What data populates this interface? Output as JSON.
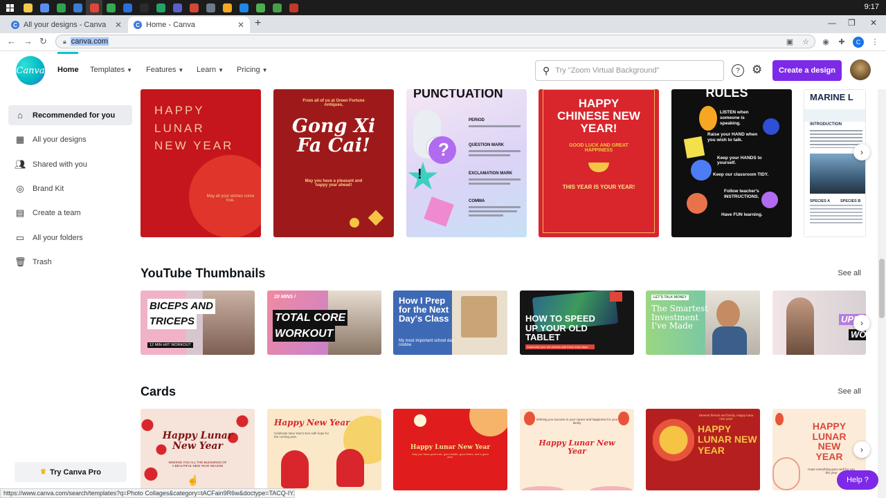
{
  "taskbar": {
    "clock": "9:17",
    "apps": [
      "#f2c94c",
      "#5b8def",
      "#2ea44f",
      "#3a7bd5",
      "#e0453a",
      "#34a853",
      "#2a6fdb",
      "#2b2b2b",
      "#21a366",
      "#5b5fc7",
      "#d14836",
      "#6b7b8c",
      "#f5a623",
      "#1e88e5",
      "#4caf50",
      "#43a047",
      "#c0392b"
    ]
  },
  "browser": {
    "tabs": [
      {
        "label": "All your designs - Canva",
        "active": false
      },
      {
        "label": "Home - Canva",
        "active": true
      }
    ],
    "url": "canva.com",
    "profile_letter": "C",
    "status_url": "https://www.canva.com/search/templates?q=Photo Collages&category=tACFain9R6w&doctype=TACQ-IY..."
  },
  "header": {
    "logo": "Canva",
    "nav": [
      {
        "label": "Home",
        "chevron": false
      },
      {
        "label": "Templates",
        "chevron": true
      },
      {
        "label": "Features",
        "chevron": true
      },
      {
        "label": "Learn",
        "chevron": true
      },
      {
        "label": "Pricing",
        "chevron": true
      }
    ],
    "search_placeholder": "Try \"Zoom Virtual Background\"",
    "create_label": "Create a design"
  },
  "sidebar": {
    "items": [
      {
        "label": "Recommended for you",
        "icon": "home-icon",
        "active": true
      },
      {
        "label": "All your designs",
        "icon": "grid-icon",
        "active": false
      },
      {
        "label": "Shared with you",
        "icon": "people-icon",
        "active": false
      },
      {
        "label": "Brand Kit",
        "icon": "brand-kit-icon",
        "active": false
      },
      {
        "label": "Create a team",
        "icon": "team-icon",
        "active": false
      },
      {
        "label": "All your folders",
        "icon": "folder-icon",
        "active": false
      },
      {
        "label": "Trash",
        "icon": "trash-icon",
        "active": false
      }
    ],
    "try_pro_label": "Try Canva Pro"
  },
  "recommended": {
    "cards": [
      {
        "title": "HAPPY LUNAR NEW YEAR",
        "sub": "May all your wishes come true.",
        "bg": "#c4161c"
      },
      {
        "title": "Gong Xi Fa Cai!",
        "sub": "May you have a pleasant and happy year ahead!",
        "top": "From all of us at Green Fortune Antiques,",
        "bg": "#9e1a1a"
      },
      {
        "title": "PUNCTUATION",
        "items": [
          "PERIOD",
          "QUESTION MARK",
          "EXCLAMATION MARK",
          "COMMA"
        ],
        "bg": "#e9e3f5"
      },
      {
        "title": "HAPPY CHINESE NEW YEAR!",
        "sub": "GOOD LUCK AND GREAT HAPPINESS",
        "foot": "THIS YEAR IS YOUR YEAR!",
        "bg": "#d8262c"
      },
      {
        "title": "RULES",
        "items": [
          "LISTEN when someone is speaking.",
          "Raise your HAND when you wish to talk.",
          "Keep your HANDS to yourself.",
          "Keep our classroom TIDY.",
          "Follow teacher's INSTRUCTIONS.",
          "Have FUN learning."
        ],
        "bg": "#0f0f0f"
      },
      {
        "title": "MARINE L",
        "items": [
          "INTRODUCTION",
          "SPECIES A",
          "SPECIES B"
        ],
        "bg": "#ffffff"
      }
    ]
  },
  "youtube": {
    "title": "YouTube Thumbnails",
    "see_all": "See all",
    "cards": [
      {
        "lines": [
          "BICEPS AND",
          "TRICEPS"
        ],
        "sub": "12 MIN HIIT WORKOUT",
        "bg": "#e9b7c9"
      },
      {
        "lines": [
          "TOTAL CORE",
          "WORKOUT"
        ],
        "sub": "20 MINS /",
        "bg": "#b47de0"
      },
      {
        "lines": [
          "How I Prep",
          "for the Next",
          "Day's Class"
        ],
        "sub": "My most important school day routine",
        "bg": "#3e6ab5"
      },
      {
        "lines": [
          "HOW TO SPEED",
          "UP YOUR OLD",
          "TABLET"
        ],
        "sub": "Customize your old devices with these easy steps",
        "bg": "#151515"
      },
      {
        "lines": [
          "The Smartest",
          "Investment",
          "I've Made"
        ],
        "sub": "LET'S TALK MONEY",
        "bg": "#8fd07a"
      },
      {
        "lines": [
          "UPPER",
          "WORK"
        ],
        "sub": "",
        "bg": "#f2e1e6"
      }
    ]
  },
  "cards_section": {
    "title": "Cards",
    "see_all": "See all",
    "cards": [
      {
        "title": "Happy Lunar New Year",
        "sub": "WISHING YOU ALL THE BLESSINGS OF A BEAUTIFUL NEW YEAR SEASON",
        "bg": "#f6e3da"
      },
      {
        "title": "Happy New Year",
        "sub": "Celebrate New Year's Eve with hope for the coming year.",
        "bg": "#fbe8c8"
      },
      {
        "title": "Happy Lunar New Year",
        "sub": "May you have good luck, good health, good times, and a good year.",
        "bg": "#e01c1c"
      },
      {
        "title": "Happy Lunar New Year",
        "sub": "Wishing you success in your career and happiness for your family",
        "bg": "#fcebd7"
      },
      {
        "title": "HAPPY LUNAR NEW YEAR",
        "sub": "Dearest friends and family, Happy lunar new year!",
        "bg": "#b51f1f"
      },
      {
        "title": "HAPPY LUNAR NEW YEAR",
        "sub": "Hope everything goes well for you this year",
        "bg": "#fcebd9"
      }
    ]
  },
  "help_label": "Help ?"
}
